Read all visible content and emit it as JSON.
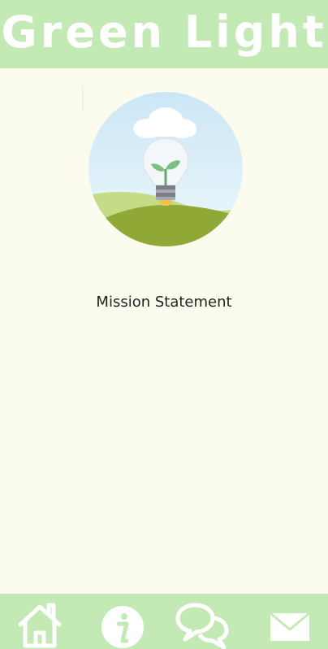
{
  "header": {
    "title": "Green Light"
  },
  "main": {
    "mission_label": "Mission Statement",
    "hero_image": "lightbulb-sprout-illustration"
  },
  "nav": {
    "items": [
      {
        "name": "home",
        "icon": "home-icon"
      },
      {
        "name": "info",
        "icon": "info-icon"
      },
      {
        "name": "chat",
        "icon": "chat-bubbles-icon"
      },
      {
        "name": "mail",
        "icon": "mail-icon"
      }
    ]
  },
  "colors": {
    "header_bg": "#c3eab4",
    "page_bg": "#fbfbee",
    "icon": "#ffffff"
  }
}
